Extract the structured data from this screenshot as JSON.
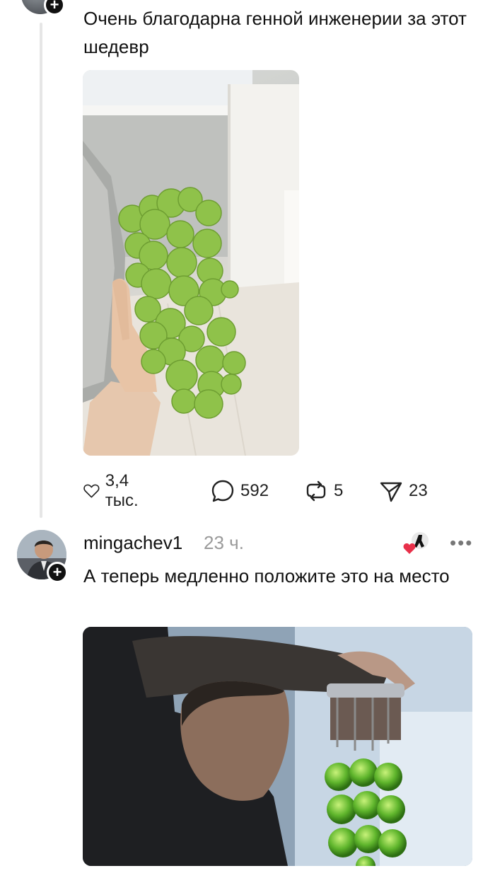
{
  "post1": {
    "text": "Очень благодарна генной инженерии за этот шедевр",
    "image_desc_icon": "green-grapes-photo",
    "actions": {
      "likes": "3,4 тыс.",
      "comments": "592",
      "reposts": "5",
      "shares": "23"
    }
  },
  "post2": {
    "username": "mingachev1",
    "time": "23 ч.",
    "text": "А теперь медленно положите это на место",
    "image_icon": "meme-photo"
  },
  "colors": {
    "accent_heart": "#e8304a",
    "muted": "#9a9a9a",
    "thread_line": "#e6e6e6"
  }
}
